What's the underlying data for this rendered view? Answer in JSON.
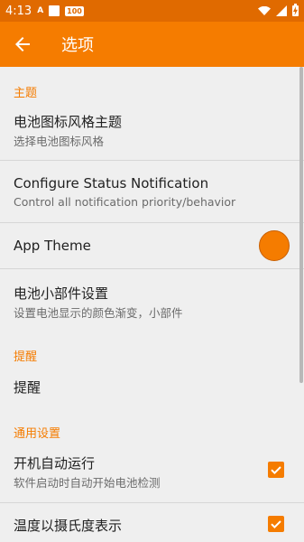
{
  "status_bar": {
    "time": "4:13",
    "notif_a": "A",
    "notif_badge": "100"
  },
  "app_bar": {
    "title": "选项"
  },
  "sections": {
    "theme_header": "主题",
    "remind_header": "提醒",
    "general_header": "通用设置"
  },
  "items": {
    "battery_icon_style": {
      "title": "电池图标风格主题",
      "summary": "选择电池图标风格"
    },
    "status_notification": {
      "title": "Configure Status Notification",
      "summary": "Control all notification priority/behavior"
    },
    "app_theme": {
      "title": "App Theme",
      "color": "#f57c00"
    },
    "widget_settings": {
      "title": "电池小部件设置",
      "summary": "设置电池显示的颜色渐变，小部件"
    },
    "remind": {
      "title": "提醒"
    },
    "auto_start": {
      "title": "开机自动运行",
      "summary": "软件启动时自动开始电池检测",
      "checked": true
    },
    "celsius": {
      "title": "温度以摄氏度表示",
      "checked": true
    }
  },
  "colors": {
    "accent": "#f57c00",
    "status_bar": "#e06a00"
  }
}
